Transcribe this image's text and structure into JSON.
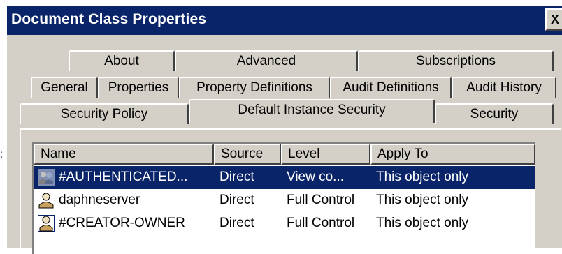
{
  "window": {
    "title": "Document Class Properties",
    "close_label": "X"
  },
  "tabs": {
    "row1": [
      "About",
      "Advanced",
      "Subscriptions"
    ],
    "row2": [
      "General",
      "Properties",
      "Property Definitions",
      "Audit Definitions",
      "Audit History"
    ],
    "row3": [
      "Security Policy",
      "Default Instance Security",
      "Security"
    ],
    "active": "Default Instance Security"
  },
  "list": {
    "columns": [
      "Name",
      "Source",
      "Level",
      "Apply To"
    ],
    "rows": [
      {
        "name": "#AUTHENTICATED...",
        "source": "Direct",
        "level": "View co...",
        "apply_to": "This object only",
        "icon": "group-icon",
        "selected": true
      },
      {
        "name": "daphneserver",
        "source": "Direct",
        "level": "Full Control",
        "apply_to": "This object only",
        "icon": "user-icon",
        "selected": false
      },
      {
        "name": "#CREATOR-OWNER",
        "source": "Direct",
        "level": "Full Control",
        "apply_to": "This object only",
        "icon": "user-icon",
        "selected": false
      }
    ]
  },
  "colors": {
    "title_bar": "#0a246a",
    "selection": "#0a246a",
    "face": "#d4d0c8"
  }
}
